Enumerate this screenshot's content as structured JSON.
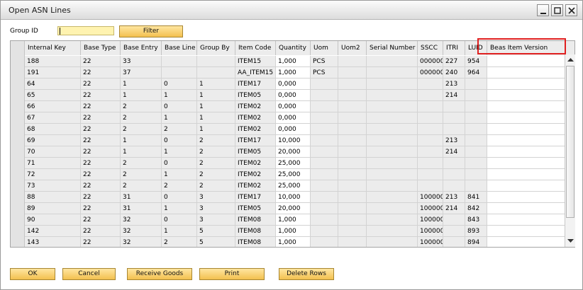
{
  "window": {
    "title": "Open ASN Lines"
  },
  "filter": {
    "group_label": "Group ID",
    "group_value": "",
    "filter_button": "Filter"
  },
  "columns": [
    "Internal Key",
    "Base Type",
    "Base Entry",
    "Base Line",
    "Group By",
    "Item Code",
    "Quantity",
    "Uom",
    "Uom2",
    "Serial Number",
    "SSCC",
    "ITRI",
    "LUID",
    "Beas Item Version"
  ],
  "rows": [
    [
      "188",
      "22",
      "33",
      "",
      "",
      "ITEM15",
      "1,000",
      "PCS",
      "",
      "",
      "000000(",
      "227",
      "954",
      ""
    ],
    [
      "191",
      "22",
      "37",
      "",
      "",
      "AA_ITEM15",
      "1,000",
      "PCS",
      "",
      "",
      "000000(",
      "240",
      "964",
      ""
    ],
    [
      "64",
      "22",
      "1",
      "0",
      "1",
      "ITEM17",
      "0,000",
      "",
      "",
      "",
      "",
      "213",
      "",
      ""
    ],
    [
      "65",
      "22",
      "1",
      "1",
      "1",
      "ITEM05",
      "0,000",
      "",
      "",
      "",
      "",
      "214",
      "",
      ""
    ],
    [
      "66",
      "22",
      "2",
      "0",
      "1",
      "ITEM02",
      "0,000",
      "",
      "",
      "",
      "",
      "",
      "",
      ""
    ],
    [
      "67",
      "22",
      "2",
      "1",
      "1",
      "ITEM02",
      "0,000",
      "",
      "",
      "",
      "",
      "",
      "",
      ""
    ],
    [
      "68",
      "22",
      "2",
      "2",
      "1",
      "ITEM02",
      "0,000",
      "",
      "",
      "",
      "",
      "",
      "",
      ""
    ],
    [
      "69",
      "22",
      "1",
      "0",
      "2",
      "ITEM17",
      "10,000",
      "",
      "",
      "",
      "",
      "213",
      "",
      ""
    ],
    [
      "70",
      "22",
      "1",
      "1",
      "2",
      "ITEM05",
      "20,000",
      "",
      "",
      "",
      "",
      "214",
      "",
      ""
    ],
    [
      "71",
      "22",
      "2",
      "0",
      "2",
      "ITEM02",
      "25,000",
      "",
      "",
      "",
      "",
      "",
      "",
      ""
    ],
    [
      "72",
      "22",
      "2",
      "1",
      "2",
      "ITEM02",
      "25,000",
      "",
      "",
      "",
      "",
      "",
      "",
      ""
    ],
    [
      "73",
      "22",
      "2",
      "2",
      "2",
      "ITEM02",
      "25,000",
      "",
      "",
      "",
      "",
      "",
      "",
      ""
    ],
    [
      "88",
      "22",
      "31",
      "0",
      "3",
      "ITEM17",
      "10,000",
      "",
      "",
      "",
      "100000(",
      "213",
      "841",
      ""
    ],
    [
      "89",
      "22",
      "31",
      "1",
      "3",
      "ITEM05",
      "20,000",
      "",
      "",
      "",
      "100000(",
      "214",
      "842",
      ""
    ],
    [
      "90",
      "22",
      "32",
      "0",
      "3",
      "ITEM08",
      "1,000",
      "",
      "",
      "",
      "100000(",
      "",
      "843",
      ""
    ],
    [
      "142",
      "22",
      "32",
      "1",
      "5",
      "ITEM08",
      "1,000",
      "",
      "",
      "",
      "100000(",
      "",
      "893",
      ""
    ],
    [
      "143",
      "22",
      "32",
      "2",
      "5",
      "ITEM08",
      "1,000",
      "",
      "",
      "",
      "100000(",
      "",
      "894",
      ""
    ]
  ],
  "buttons": {
    "ok": "OK",
    "cancel": "Cancel",
    "receive": "Receive Goods",
    "print": "Print",
    "delete": "Delete Rows"
  }
}
